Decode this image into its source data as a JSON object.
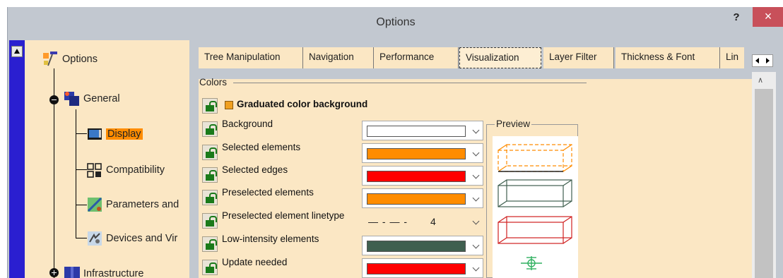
{
  "window": {
    "title": "Options",
    "help_label": "?",
    "close_label": "×"
  },
  "tree": {
    "root": "Options",
    "general": "General",
    "display": "Display",
    "compatibility": "Compatibility",
    "parameters": "Parameters and",
    "devices": "Devices and Vir",
    "infrastructure": "Infrastructure"
  },
  "tabs": [
    {
      "label": "Tree Manipulation"
    },
    {
      "label": "Navigation"
    },
    {
      "label": "Performance"
    },
    {
      "label": "Visualization"
    },
    {
      "label": "Layer Filter"
    },
    {
      "label": "Thickness & Font"
    },
    {
      "label": "Lin"
    }
  ],
  "colors_group": {
    "label": "Colors",
    "graduated_label": "Graduated color background",
    "preview_label": "Preview",
    "rows": [
      {
        "label": "Background",
        "color": "#ffffff"
      },
      {
        "label": "Selected elements",
        "color": "#ff8c00"
      },
      {
        "label": "Selected edges",
        "color": "#ff0000"
      },
      {
        "label": "Preselected elements",
        "color": "#ff8c00"
      },
      {
        "label": "Preselected element linetype",
        "linetype": "— - — -",
        "linetype_value": "4"
      },
      {
        "label": "Low-intensity elements",
        "color": "#3f5f4f"
      },
      {
        "label": "Update needed",
        "color": "#ff0000"
      }
    ]
  },
  "icons": {
    "tree_root": "options-tree-icon",
    "lock": "lock-icon",
    "preview": "preview-boxes-icon"
  }
}
